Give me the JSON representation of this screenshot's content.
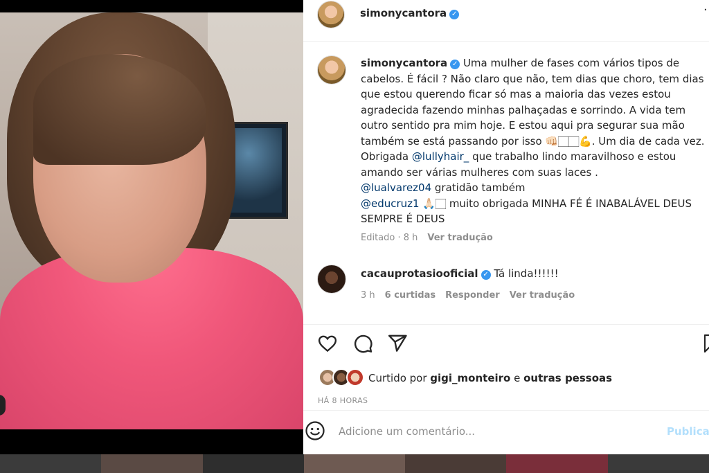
{
  "post": {
    "author": "simonycantora",
    "verified_mark": "✓",
    "more_icon": "···"
  },
  "caption": {
    "author": "simonycantora",
    "text_1": "Uma mulher de fases com vários tipos de cabelos. É fácil ? Não claro que não, tem dias que choro, tem dias que estou querendo ficar só mas a maioria das vezes estou agradecida fazendo minhas palhaçadas e sorrindo. A vida tem outro sentido pra mim hoje. E estou aqui pra segurar sua mão também se está passando por isso 👊🏻🏻🏻💪. Um dia de cada vez.",
    "text_2": "Obrigada",
    "mention_1": "@lullyhair_",
    "text_3": " que trabalho lindo maravilhoso e estou amando ser várias mulheres com suas laces .",
    "mention_2": "@lualvarez04",
    "text_4": " gratidão também",
    "mention_3": "@educruz1",
    "text_5": " 🙏🏻🏻 muito obrigada MINHA FÉ É INABALÁVEL DEUS SEMPRE É DEUS",
    "edited": "Editado · 8 h",
    "see_translation": "Ver tradução"
  },
  "comment": {
    "author": "cacauprotasiooficial",
    "text": "Tá linda!!!!!!",
    "time": "3 h",
    "likes": "6 curtidas",
    "reply": "Responder",
    "see_translation": "Ver tradução"
  },
  "actions": {
    "like_icon": "heart-icon",
    "comment_icon": "comment-icon",
    "share_icon": "share-icon",
    "save_icon": "bookmark-icon"
  },
  "likes": {
    "prefix": "Curtido por ",
    "user": "gigi_monteiro",
    "mid": " e ",
    "others": "outras pessoas"
  },
  "timestamp": "HÁ 8 HORAS",
  "add_comment": {
    "placeholder": "Adicione um comentário...",
    "post_label": "Publicar"
  },
  "colors": {
    "accent_blue": "#3897f0",
    "mention": "#00376b",
    "muted": "#8e8e8e",
    "robe_pink": "#f0577a"
  }
}
